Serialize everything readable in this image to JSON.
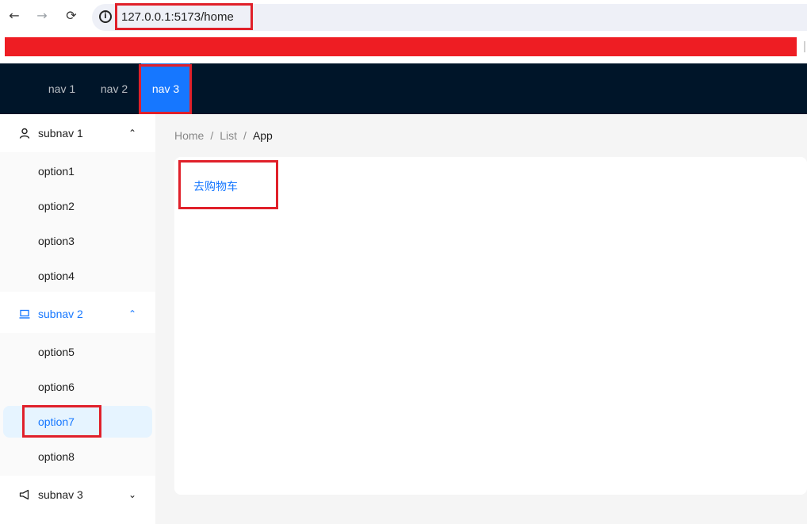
{
  "browser": {
    "url": "127.0.0.1:5173/home",
    "back_icon": "arrow-left-icon",
    "forward_icon": "arrow-right-icon",
    "reload_icon": "reload-icon",
    "info_icon": "info-icon"
  },
  "banner": {
    "color": "#ee1d23"
  },
  "header": {
    "background": "#001529",
    "nav_items": [
      {
        "label": "nav 1",
        "selected": false
      },
      {
        "label": "nav 2",
        "selected": false
      },
      {
        "label": "nav 3",
        "selected": true
      }
    ]
  },
  "sidebar": {
    "submenus": [
      {
        "label": "subnav 1",
        "icon": "user-icon",
        "expanded": true,
        "options": [
          "option1",
          "option2",
          "option3",
          "option4"
        ]
      },
      {
        "label": "subnav 2",
        "icon": "laptop-icon",
        "expanded": true,
        "active": true,
        "options": [
          "option5",
          "option6",
          "option7",
          "option8"
        ],
        "selected_option": "option7"
      },
      {
        "label": "subnav 3",
        "icon": "notification-icon",
        "expanded": false,
        "options": []
      }
    ]
  },
  "main": {
    "breadcrumb": [
      "Home",
      "List",
      "App"
    ],
    "breadcrumb_separator": "/",
    "cart_link": "去购物车"
  },
  "colors": {
    "primary": "#1677ff",
    "selected_bg": "#e6f4ff",
    "highlight_box": "#e0202a"
  }
}
